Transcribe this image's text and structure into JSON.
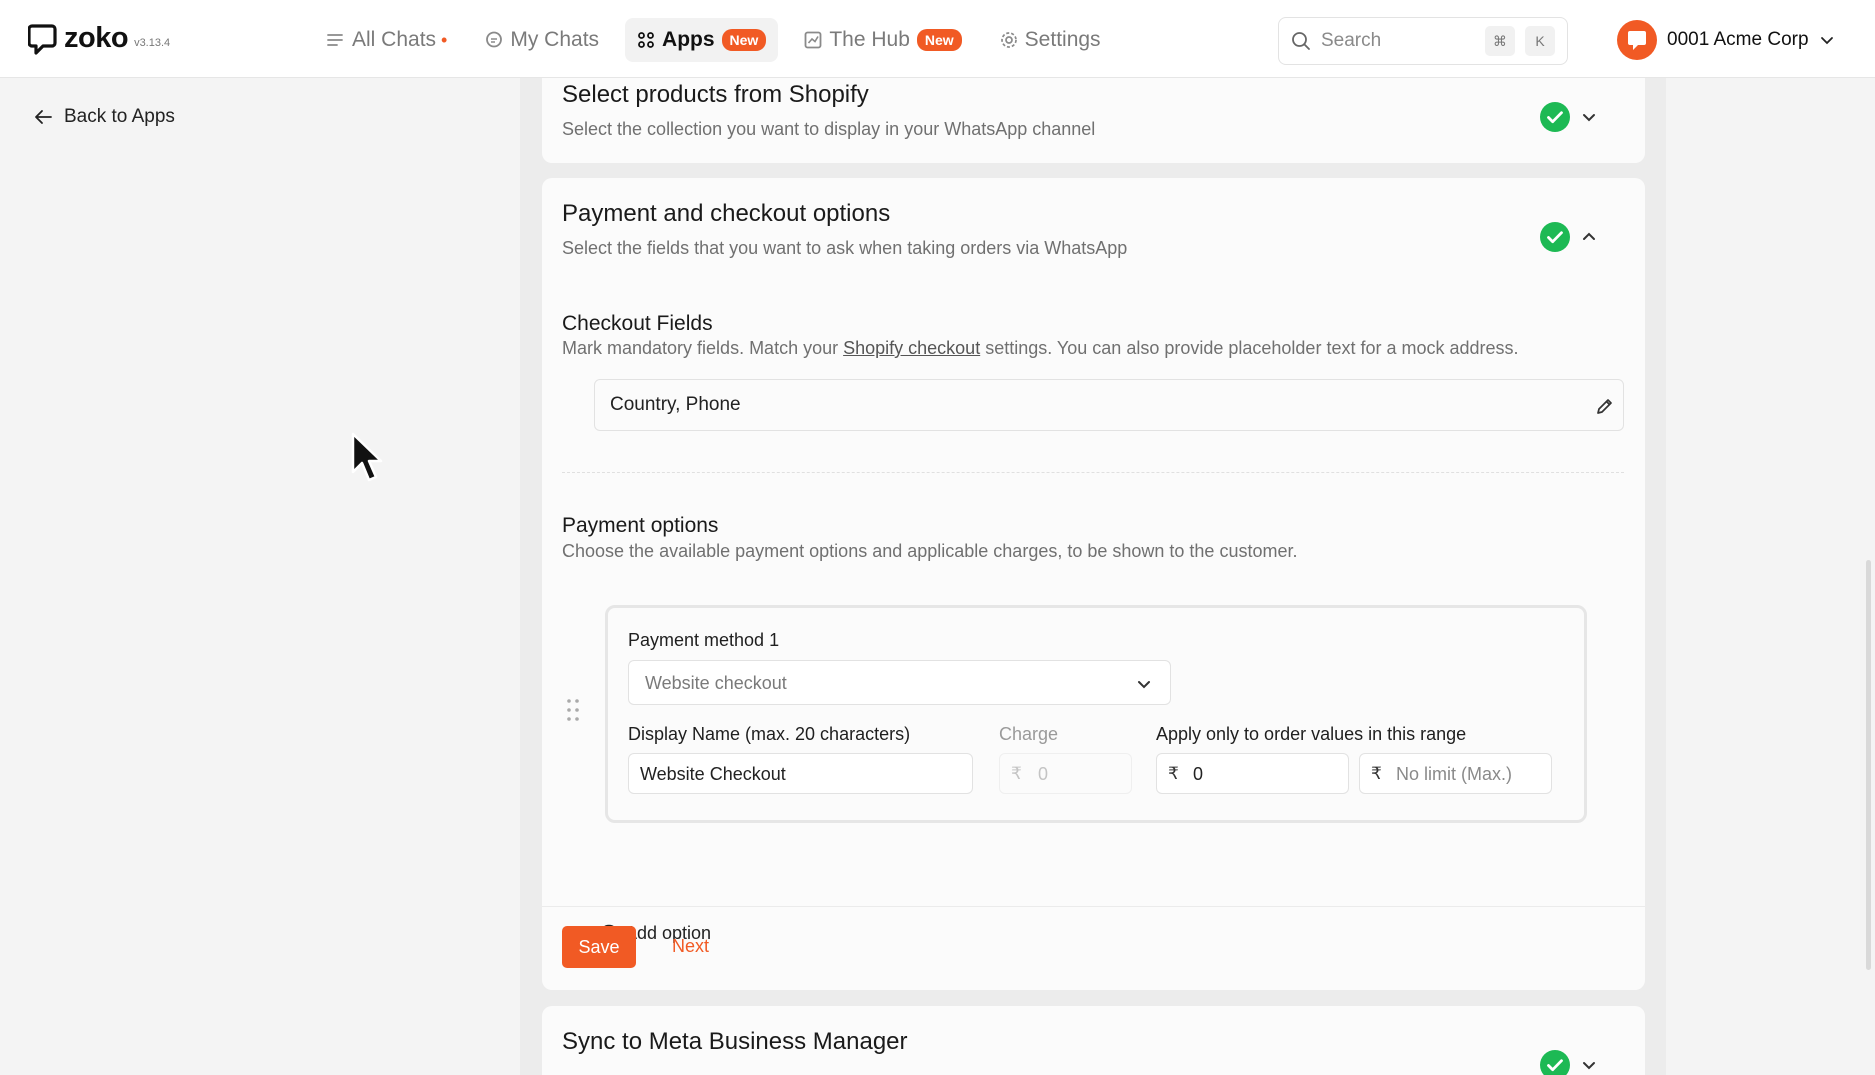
{
  "topbar": {
    "brand": {
      "name": "zoko",
      "version": "v3.13.4"
    },
    "nav": [
      {
        "label": "All Chats",
        "icon": "list-icon",
        "dot": "•"
      },
      {
        "label": "My Chats",
        "icon": "chat-icon"
      },
      {
        "label": "Apps",
        "icon": "apps-grid-icon",
        "badge": "New"
      },
      {
        "label": "The Hub",
        "icon": "chart-icon",
        "badge": "New"
      },
      {
        "label": "Settings",
        "icon": "gear-icon"
      }
    ],
    "search": {
      "placeholder": "Search",
      "shortcut_cmd": "⌘",
      "shortcut_key": "K"
    },
    "org": {
      "name": "0001 Acme Corp"
    }
  },
  "sidebar": {
    "back_label": "Back to Apps"
  },
  "sections": {
    "shopify": {
      "title": "Select products from Shopify",
      "subtitle": "Select the collection you want to display in your WhatsApp channel"
    },
    "payment": {
      "title": "Payment and checkout options",
      "subtitle": "Select the fields that you want to ask when taking orders via WhatsApp",
      "checkout_fields": {
        "title": "Checkout Fields",
        "desc_before": "Mark mandatory fields. Match your ",
        "desc_link": "Shopify checkout",
        "desc_after": " settings. You can also provide placeholder text for a mock address.",
        "value": "Country, Phone"
      },
      "payment_options": {
        "title": "Payment options",
        "desc": "Choose the available payment options and applicable charges, to be shown to the customer.",
        "method": {
          "label": "Payment method 1",
          "selected": "Website checkout",
          "display_name_label": "Display Name (max. 20 characters)",
          "display_name_value": "Website Checkout",
          "charge_label": "Charge",
          "charge_currency": "₹",
          "charge_value": "0",
          "range_label": "Apply only to order values in this range",
          "range_min_currency": "₹",
          "range_min_value": "0",
          "range_max_currency": "₹",
          "range_max_placeholder": "No limit (Max.)"
        },
        "add_option_label": "Add option"
      },
      "save_label": "Save",
      "next_label": "Next"
    },
    "meta": {
      "title": "Sync to Meta Business Manager"
    }
  },
  "colors": {
    "accent": "#f15a24",
    "success": "#1db954"
  }
}
